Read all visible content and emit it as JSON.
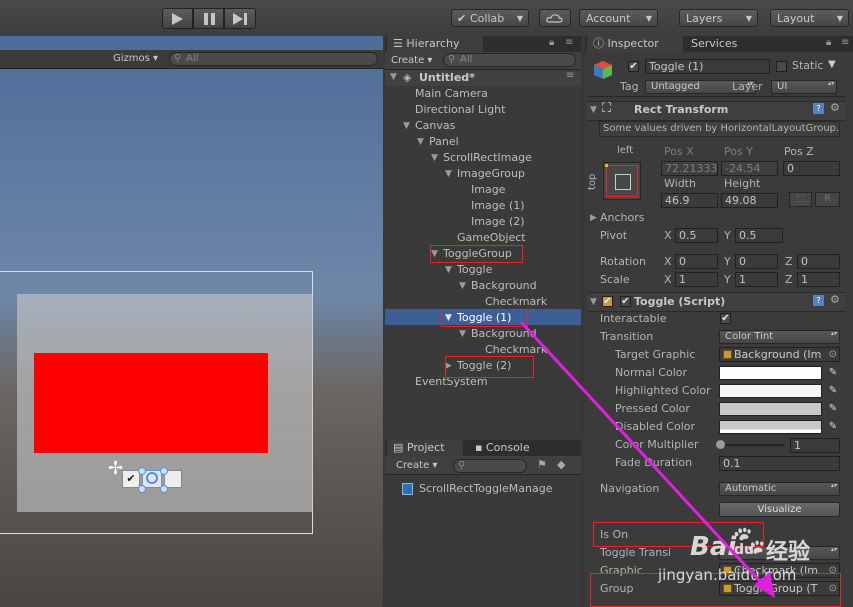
{
  "toolbar": {
    "play_icon": "play-icon",
    "pause_icon": "pause-icon",
    "step_icon": "step-icon",
    "collab_label": "Collab",
    "cloud_icon": "cloud-icon",
    "account_label": "Account",
    "layers_label": "Layers",
    "layout_label": "Layout"
  },
  "scene": {
    "gizmos_label": "Gizmos",
    "search_placeholder": "All"
  },
  "hierarchy": {
    "tab_label": "Hierarchy",
    "create_label": "Create",
    "search_placeholder": "All",
    "scene_name": "Untitled*",
    "items": [
      {
        "label": "Main Camera"
      },
      {
        "label": "Directional Light"
      },
      {
        "label": "Canvas"
      },
      {
        "label": "Panel"
      },
      {
        "label": "ScrollRectImage"
      },
      {
        "label": "ImageGroup"
      },
      {
        "label": "Image"
      },
      {
        "label": "Image (1)"
      },
      {
        "label": "Image (2)"
      },
      {
        "label": "GameObject"
      },
      {
        "label": "ToggleGroup"
      },
      {
        "label": "Toggle"
      },
      {
        "label": "Background"
      },
      {
        "label": "Checkmark"
      },
      {
        "label": "Toggle (1)"
      },
      {
        "label": "Background"
      },
      {
        "label": "Checkmark"
      },
      {
        "label": "Toggle (2)"
      },
      {
        "label": "EventSystem"
      }
    ]
  },
  "project": {
    "tab_label": "Project",
    "console_label": "Console",
    "create_label": "Create",
    "asset": "ScrollRectToggleManage"
  },
  "inspector": {
    "tab_label": "Inspector",
    "services_label": "Services",
    "object_name": "Toggle (1)",
    "static_label": "Static",
    "tag_label": "Tag",
    "tag_value": "Untagged",
    "layer_label": "Layer",
    "layer_value": "UI",
    "rect": {
      "title": "Rect Transform",
      "note": "Some values driven by HorizontalLayoutGroup.",
      "anchor_h": "left",
      "anchor_v": "top",
      "posx_label": "Pos X",
      "posy_label": "Pos Y",
      "posz_label": "Pos Z",
      "posx": "72.21333",
      "posy": "-24.54",
      "posz": "0",
      "width_label": "Width",
      "height_label": "Height",
      "width": "46.9",
      "height": "49.08",
      "r_label": "R",
      "anchors_label": "Anchors",
      "pivot_label": "Pivot",
      "pivot_x": "0.5",
      "pivot_y": "0.5",
      "rotation_label": "Rotation",
      "rot_x": "0",
      "rot_y": "0",
      "rot_z": "0",
      "scale_label": "Scale",
      "scale_x": "1",
      "scale_y": "1",
      "scale_z": "1",
      "x": "X",
      "y": "Y",
      "z": "Z"
    },
    "toggle": {
      "title": "Toggle (Script)",
      "interactable_label": "Interactable",
      "transition_label": "Transition",
      "transition_value": "Color Tint",
      "target_graphic_label": "Target Graphic",
      "target_graphic_value": "Background (Im",
      "normal_color_label": "Normal Color",
      "highlighted_color_label": "Highlighted Color",
      "pressed_color_label": "Pressed Color",
      "disabled_color_label": "Disabled Color",
      "color_multiplier_label": "Color Multiplier",
      "color_multiplier_value": "1",
      "fade_duration_label": "Fade Duration",
      "fade_duration_value": "0.1",
      "navigation_label": "Navigation",
      "navigation_value": "Automatic",
      "visualize_label": "Visualize",
      "is_on_label": "Is On",
      "toggle_transition_label": "Toggle Transi",
      "graphic_label": "Graphic",
      "graphic_value": "Checkmark (Im",
      "group_label": "Group",
      "group_value": "ToggleGroup (T"
    }
  },
  "watermark": {
    "brand": "Bai",
    "brand2": "du",
    "cn": "经验",
    "url": "jingyan.baidu.com"
  },
  "colors": {
    "highlight_box": "#e8242b",
    "arrow": "#e01fe0",
    "selected_row": "#3e5f96",
    "red_image": "#ff0000"
  }
}
